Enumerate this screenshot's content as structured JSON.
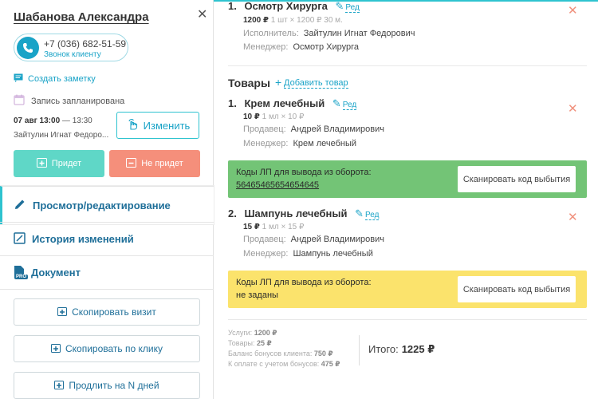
{
  "client": {
    "name": "Шабанова Александра",
    "phone": "+7 (036) 682-51-59",
    "call_label": "Звонок клиенту",
    "note_link": "Создать заметку",
    "schedule_status": "Запись запланирована",
    "visit_date": "07 авг  13:00",
    "visit_end": " — 13:30",
    "visit_employee": "Зайтулин Игнат Федоро...",
    "change_label": "Изменить",
    "come_label": "Придет",
    "nocome_label": "Не придет"
  },
  "menu": {
    "view_edit": "Просмотр/редактирование",
    "history": "История изменений",
    "document": "Документ",
    "pro": "PRO"
  },
  "actions": {
    "copy_visit": "Скопировать визит",
    "copy_click": "Скопировать по клику",
    "extend": "Продлить на N дней"
  },
  "service": {
    "num": "1.",
    "title": "Осмотр Хирурга",
    "edit": "Ред",
    "price": "1200 ₽",
    "detail": "  1 шт × 1200 ₽  30 м.",
    "performer_label": "Исполнитель:",
    "performer": "Зайтулин Игнат Федорович",
    "manager_label": "Менеджер:",
    "manager": "Осмотр Хирурга"
  },
  "goods": {
    "title": "Товары",
    "add_label": "Добавить товар",
    "items": [
      {
        "num": "1.",
        "title": "Крем лечебный",
        "edit": "Ред",
        "price": "10 ₽",
        "detail": "  1 мл × 10 ₽",
        "seller_label": "Продавец:",
        "seller": "Андрей Владимирович",
        "manager_label": "Менеджер:",
        "manager": "Крем лечебный",
        "codes_label": "Коды ЛП для вывода из оборота:",
        "codes_value": "56465465654654645",
        "scan_label": "Сканировать код выбытия"
      },
      {
        "num": "2.",
        "title": "Шампунь лечебный",
        "edit": "Ред",
        "price": "15 ₽",
        "detail": "  1 мл × 15 ₽",
        "seller_label": "Продавец:",
        "seller": "Андрей Владимирович",
        "manager_label": "Менеджер:",
        "manager": "Шампунь лечебный",
        "codes_label": "Коды ЛП для вывода из оборота:",
        "codes_value": "не заданы",
        "scan_label": "Сканировать код выбытия"
      }
    ]
  },
  "summary": {
    "services_label": "Услуги:",
    "services": "1200 ₽",
    "goods_label": "Товары:",
    "goods": "25 ₽",
    "bonus_label": "Баланс бонусов клиента:",
    "bonus": "750 ₽",
    "topay_label": "К оплате с учетом бонусов:",
    "topay": "475 ₽",
    "total_label": "Итого:",
    "total": "1225 ₽"
  },
  "colors": {
    "accent": "#19a3c7",
    "come": "#5fd7c7",
    "nocome": "#f58f7b",
    "codes_ok": "#73c476",
    "codes_missing": "#fbe36c"
  }
}
